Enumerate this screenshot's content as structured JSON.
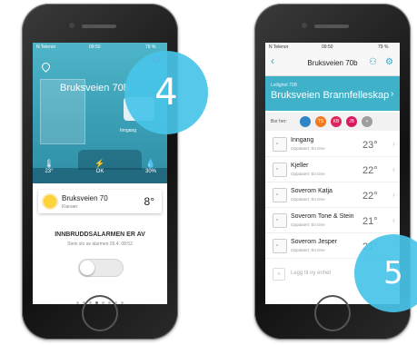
{
  "left_phone": {
    "status": {
      "carrier": "N Telenor",
      "time": "09:50",
      "battery": "79 %"
    },
    "hero": {
      "title": "Bruksveien 70b",
      "badge": "1",
      "room_tag": "Inngang",
      "stats": [
        {
          "glyph": "🌡",
          "value": "23°"
        },
        {
          "glyph": "⚡",
          "value": "OK"
        },
        {
          "glyph": "💧",
          "value": "30%"
        }
      ]
    },
    "weather_card": {
      "title": "Bruksveien 70",
      "subtitle": "Klarvær",
      "temp": "8°"
    },
    "alarm": {
      "title": "INNBRUDDSALARMEN ER AV",
      "subtitle": "Stein slo av alarmen 26.4. 08:52",
      "armed": false
    },
    "pager": {
      "count": 8,
      "active": 3
    }
  },
  "right_phone": {
    "status": {
      "carrier": "N Telenor",
      "time": "09:50",
      "battery": "79 %"
    },
    "nav": {
      "back": "‹",
      "title": "Bruksveien 70b"
    },
    "banner": {
      "label": "Leilighet 70B",
      "title": "Bruksveien Brannfelleskap"
    },
    "residents": {
      "label": "Bor her:",
      "avatars": [
        {
          "initials": "",
          "color": "#2f86c7"
        },
        {
          "initials": "TS",
          "color": "#f07a1e"
        },
        {
          "initials": "KB",
          "color": "#e0245e"
        },
        {
          "initials": "JB",
          "color": "#d81b60"
        },
        {
          "initials": "+",
          "color": "#9e9e9e"
        }
      ]
    },
    "devices": [
      {
        "name": "Inngang",
        "updated": "Oppdatert: Én time",
        "temp": "23°"
      },
      {
        "name": "Kjeller",
        "updated": "Oppdatert: Én time",
        "temp": "22°"
      },
      {
        "name": "Soverom Katja",
        "updated": "Oppdatert: Én time",
        "temp": "22°"
      },
      {
        "name": "Soverom Tone & Stein",
        "updated": "Oppdatert: Én time",
        "temp": "21°"
      },
      {
        "name": "Soverom Jesper",
        "updated": "Oppdatert: Én time",
        "temp": "21°"
      }
    ],
    "add_device": {
      "icon": "+",
      "label": "Legg til ny enhet"
    }
  },
  "steps": {
    "left": "4",
    "right": "5"
  },
  "colors": {
    "accent": "#3fb1c9",
    "step_circle": "#48c4e8"
  }
}
